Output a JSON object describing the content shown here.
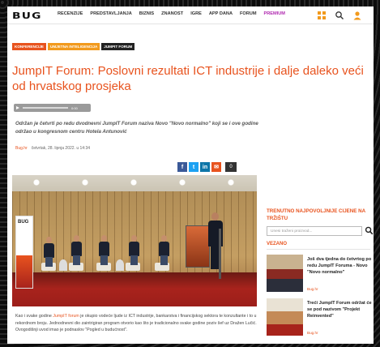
{
  "nav": {
    "logo": "BUG",
    "items": [
      "RECENZIJE",
      "PREDSTAVLJANJA",
      "BIZNIS",
      "ZNANOST",
      "IGRE",
      "APP DANA",
      "FORUM",
      "PREMIUM"
    ]
  },
  "article": {
    "tags": [
      "KONFERENCIJE",
      "UMJETNA INTELIGENCIJA",
      "JUMPIT FORUM"
    ],
    "title": "JumpIT Forum: Poslovni rezultati ICT industrije i dalje daleko veći od hrvatskog prosjeka",
    "player_time": "0:00",
    "lead": "Održan je četvrti po redu dvodnevni JumpIT Forum naziva Novo \"Novo normalno\" koji se i ove godine održao u kongresnom centru Hotela Antunović",
    "author": "Bug.hr",
    "date": "četvrtak, 28. lipnja 2022. u 14:34",
    "share_count": "0",
    "photo_banner": "BUG",
    "body_before_link": "Kao i svake godine ",
    "body_link": "JumpIT forum",
    "body_after_link": " je okupio vodeće ljude iz ICT industrije, bankarstva i financijskog sektora te konzultante i to u rekordnom broju. Jednodnevni dio zaintrigiran program otvorio kao što je tradicionalno svake godine poziv šef uz Dražen Lučić. Ovogodišnji uvod imao je podnaslov \"Pogled u budućnost\"."
  },
  "sidebar": {
    "heading": "TRENUTNO NAJPOVOLJNIJE CIJENE NA TRŽIŠTU",
    "search_placeholder": "Unesi traženi proizvod...",
    "subheading": "VEZANO",
    "related": [
      {
        "title": "Još dva tjedna do četvrtog po redu JumpIT Foruma - Novo \"Novo normalno\"",
        "meta": "Bug.hr"
      },
      {
        "title": "Treći JumpIT Forum održat će se pod nazivom \"Projekt Reinvented\"",
        "meta": "Bug.hr"
      }
    ]
  },
  "colors": {
    "accent": "#e8531e",
    "premium": "#b02ab0"
  },
  "icons": [
    "grid-icon",
    "search-icon",
    "user-icon",
    "play-icon",
    "facebook-icon",
    "twitter-icon",
    "linkedin-icon",
    "email-icon"
  ]
}
